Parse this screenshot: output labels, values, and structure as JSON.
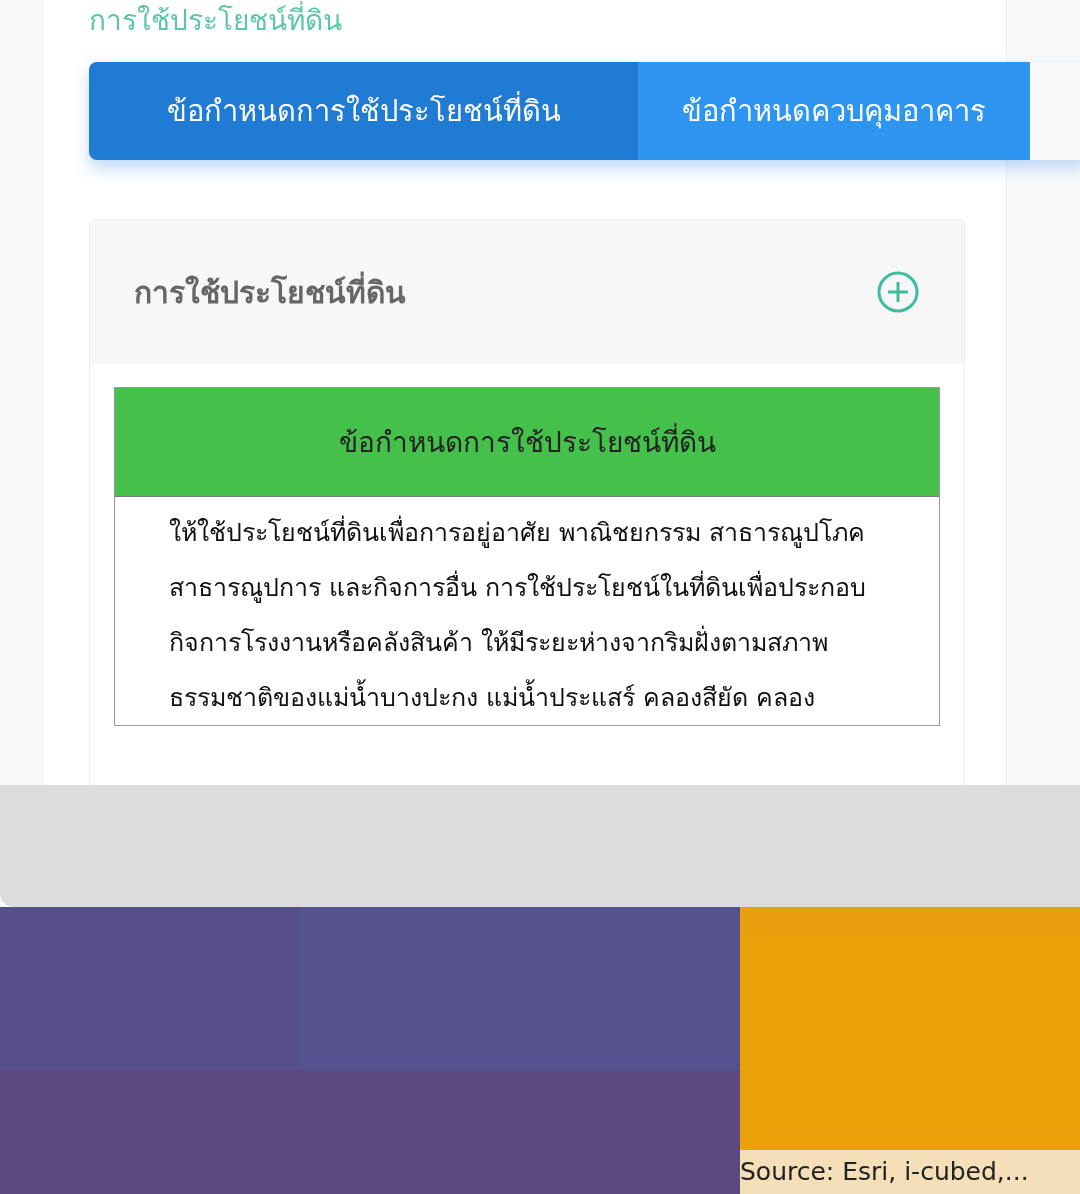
{
  "page_title": "การใช้ประโยชน์ที่ดิน",
  "tabs": [
    {
      "label": "ข้อกำหนดการใช้ประโยชน์ที่ดิน",
      "selected": true
    },
    {
      "label": "ข้อกำหนดควบคุมอาคาร",
      "selected": false
    }
  ],
  "card": {
    "title": "การใช้ประโยชน์ที่ดิน",
    "table": {
      "header": "ข้อกำหนดการใช้ประโยชน์ที่ดิน",
      "body": "ให้ใช้ประโยชน์ที่ดินเพื่อการอยู่อาศัย พาณิชยกรรม สาธารณูปโภค สาธารณูปการ และกิจการอื่น การใช้ประโยชน์ในที่ดินเพื่อประกอบกิจการโรงงานหรือคลังสินค้า ให้มีระยะห่างจากริมฝั่งตามสภาพธรรมชาติของแม่น้ำบางปะกง แม่น้ำประแสร์ คลองสียัด คลอง"
    }
  },
  "map": {
    "attribution": "Source: Esri, i-cubed,..."
  }
}
